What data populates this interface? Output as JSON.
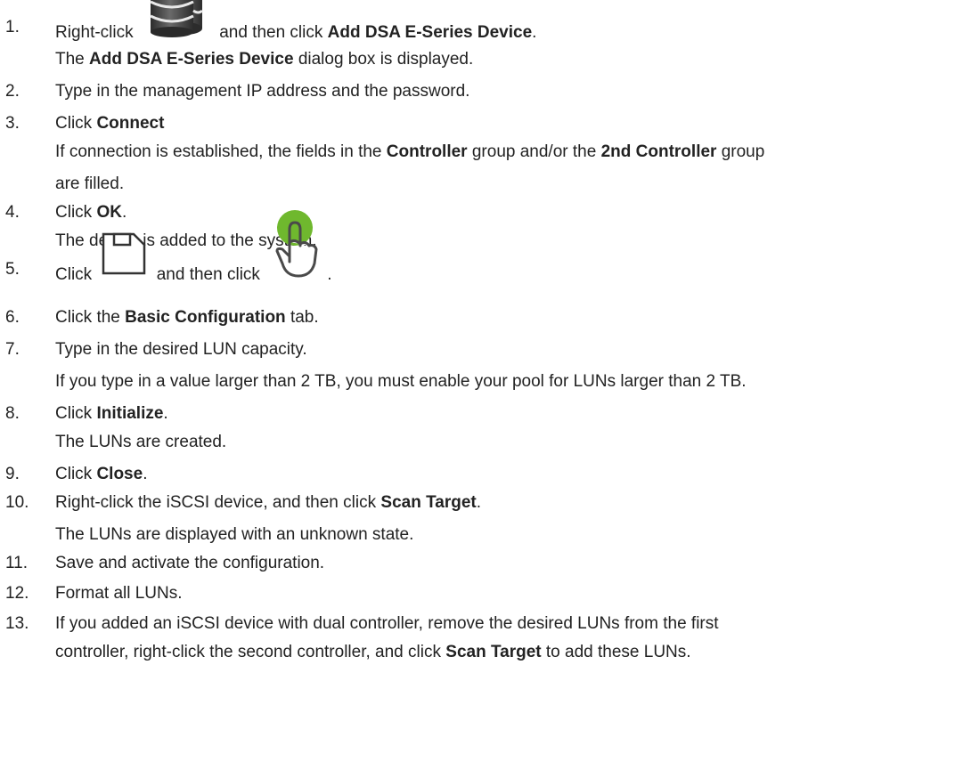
{
  "steps": [
    {
      "number": "1.",
      "pre": "Right-click",
      "icon": "storage-database-icon",
      "mid": "and then click",
      "bold": "Add DSA E-Series Device",
      "post": ".",
      "sub": {
        "pre": "The",
        "bold": "Add DSA E-Series Device",
        "post": "dialog box is displayed."
      }
    },
    {
      "number": "2.",
      "text": "Type in the management IP address and the password."
    },
    {
      "number": "3.",
      "pre": "Click",
      "bold": "Connect",
      "sub1": {
        "pre": "If connection is established, the fields in the",
        "bold1": "Controller",
        "mid": "group and/or the",
        "bold2": "2nd Controller",
        "post": "group"
      },
      "sub2": "are filled."
    },
    {
      "number": "4.",
      "pre": "Click",
      "bold": "OK",
      "post": ".",
      "sub": "The device is added to the system."
    },
    {
      "number": "5.",
      "pre": "Click",
      "icon1": "save-icon",
      "mid": "and then click",
      "icon2": "activate-hand-icon",
      "post": "."
    },
    {
      "number": "6.",
      "pre": "Click the",
      "bold": "Basic Configuration",
      "post": "tab."
    },
    {
      "number": "7.",
      "text": "Type in the desired LUN capacity.",
      "sub": "If you type in a value larger than 2 TB, you must enable your pool for LUNs larger than 2 TB."
    },
    {
      "number": "8.",
      "pre": "Click",
      "bold": "Initialize",
      "post": ".",
      "sub": "The LUNs are created."
    },
    {
      "number": "9.",
      "pre": "Click",
      "bold": "Close",
      "post": "."
    },
    {
      "number": "10.",
      "pre": "Right-click the iSCSI device, and then click",
      "bold": "Scan Target",
      "post": ".",
      "sub": "The LUNs are displayed with an unknown state."
    },
    {
      "number": "11.",
      "text": "Save and activate the configuration."
    },
    {
      "number": "12.",
      "text": "Format all LUNs."
    },
    {
      "number": "13.",
      "text": "If you added an iSCSI device with dual controller, remove the desired LUNs from the first",
      "sub": {
        "pre": "controller, right-click the second controller, and click",
        "bold": "Scan Target",
        "post": "to add these LUNs."
      }
    }
  ],
  "colors": {
    "text": "#222222",
    "icon_green": "#6fb82e",
    "icon_dark": "#4a4a4a"
  }
}
